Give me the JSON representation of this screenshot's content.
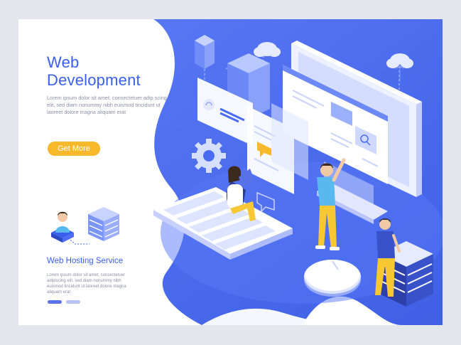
{
  "hero": {
    "title_line1": "Web",
    "title_line2": "Development",
    "lorem": "Lorem ipsum dolor sit amet, consectetuer adip scing elit, sed diam nonummy nibh euismod tincidunt ut laoreet dolore magna aliquam erat",
    "cta_label": "Get More"
  },
  "hosting": {
    "title": "Web Hosting Service",
    "text": "Lorem ipsum dolor sit amet, consectetuer adipiscing elit, sed diam nonummy nibh euismod tincidunt ut laoreet dolore magna aliquam erat"
  },
  "pager": {
    "count": 2,
    "active": 1
  },
  "colors": {
    "accent": "#4a6cf3",
    "title": "#3a5ff0",
    "button": "#f7b82a",
    "page_bg": "#e4e6ee"
  },
  "icons": [
    "user-avatar-icon",
    "server-stack-icon",
    "cloud-upload-icon",
    "gear-icon",
    "keyboard-icon",
    "mouse-icon",
    "chat-bubble-icon",
    "search-icon"
  ]
}
